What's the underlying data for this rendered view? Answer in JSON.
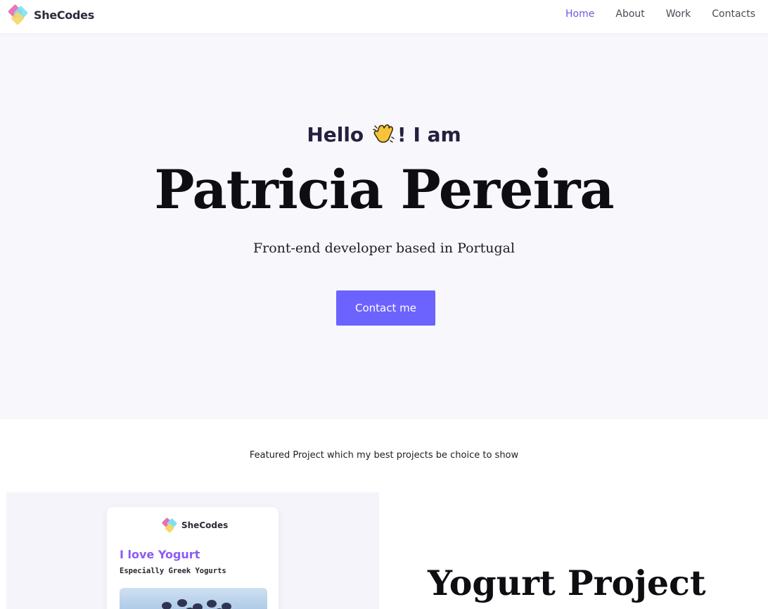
{
  "navbar": {
    "brand": "SheCodes",
    "links": [
      {
        "label": "Home",
        "active": true
      },
      {
        "label": "About",
        "active": false
      },
      {
        "label": "Work",
        "active": false
      },
      {
        "label": "Contacts",
        "active": false
      }
    ]
  },
  "hero": {
    "greeting_pre": "Hello",
    "greeting_icon": "waving-hand-icon",
    "greeting_post": "! I am",
    "name": "Patricia Pereira",
    "subtitle": "Front-end developer based in Portugal",
    "cta_label": "Contact me"
  },
  "featured": {
    "caption": "Featured Project which my best projects be choice to show"
  },
  "project": {
    "preview": {
      "brand": "SheCodes",
      "title": "I love Yogurt",
      "subtitle": "Especially Greek Yogurts"
    },
    "title": "Yogurt Project"
  },
  "colors": {
    "accent": "#6c63ff",
    "nav_active": "#6a5ae0",
    "hero_bg": "#f8f7fc",
    "preview_title": "#8a5cf6"
  }
}
